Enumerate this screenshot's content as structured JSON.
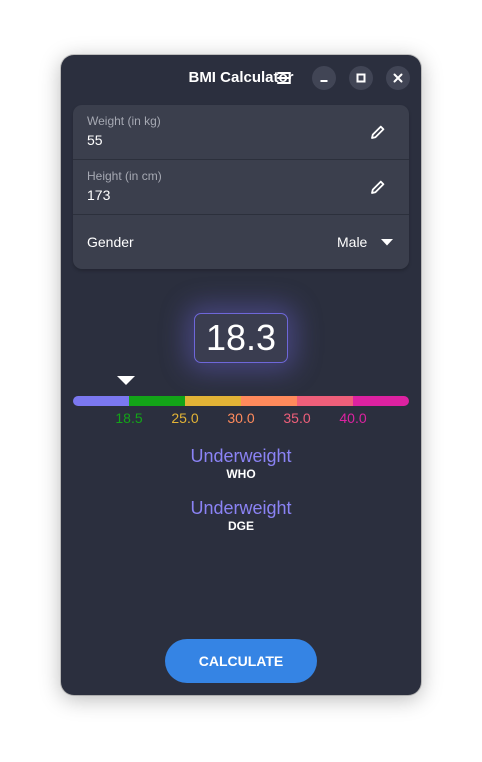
{
  "window": {
    "title": "BMI Calculator"
  },
  "header_buttons": {
    "menu": "menu-icon",
    "minimize": "minimize-icon",
    "maximize": "maximize-icon",
    "close": "close-icon"
  },
  "inputs": {
    "weight": {
      "label": "Weight (in kg)",
      "value": "55",
      "icon": "edit-icon"
    },
    "height": {
      "label": "Height (in cm)",
      "value": "173",
      "icon": "edit-icon"
    },
    "gender": {
      "label": "Gender",
      "selected": "Male",
      "icon": "dropdown-arrow-icon"
    }
  },
  "result": {
    "bmi": "18.3"
  },
  "scale": {
    "colors": [
      "#7b78f0",
      "#13a418",
      "#e2b336",
      "#ff8a5c",
      "#ef5f7a",
      "#dd22a1"
    ],
    "ticks": [
      {
        "label": "18.5",
        "color": "#13a418"
      },
      {
        "label": "25.0",
        "color": "#e2b336"
      },
      {
        "label": "30.0",
        "color": "#ff8a5c"
      },
      {
        "label": "35.0",
        "color": "#ef5f7a"
      },
      {
        "label": "40.0",
        "color": "#dd22a1"
      }
    ]
  },
  "classifications": [
    {
      "label": "Underweight",
      "source": "WHO"
    },
    {
      "label": "Underweight",
      "source": "DGE"
    }
  ],
  "actions": {
    "calculate": "CALCULATE"
  },
  "accent": "#3584e4"
}
